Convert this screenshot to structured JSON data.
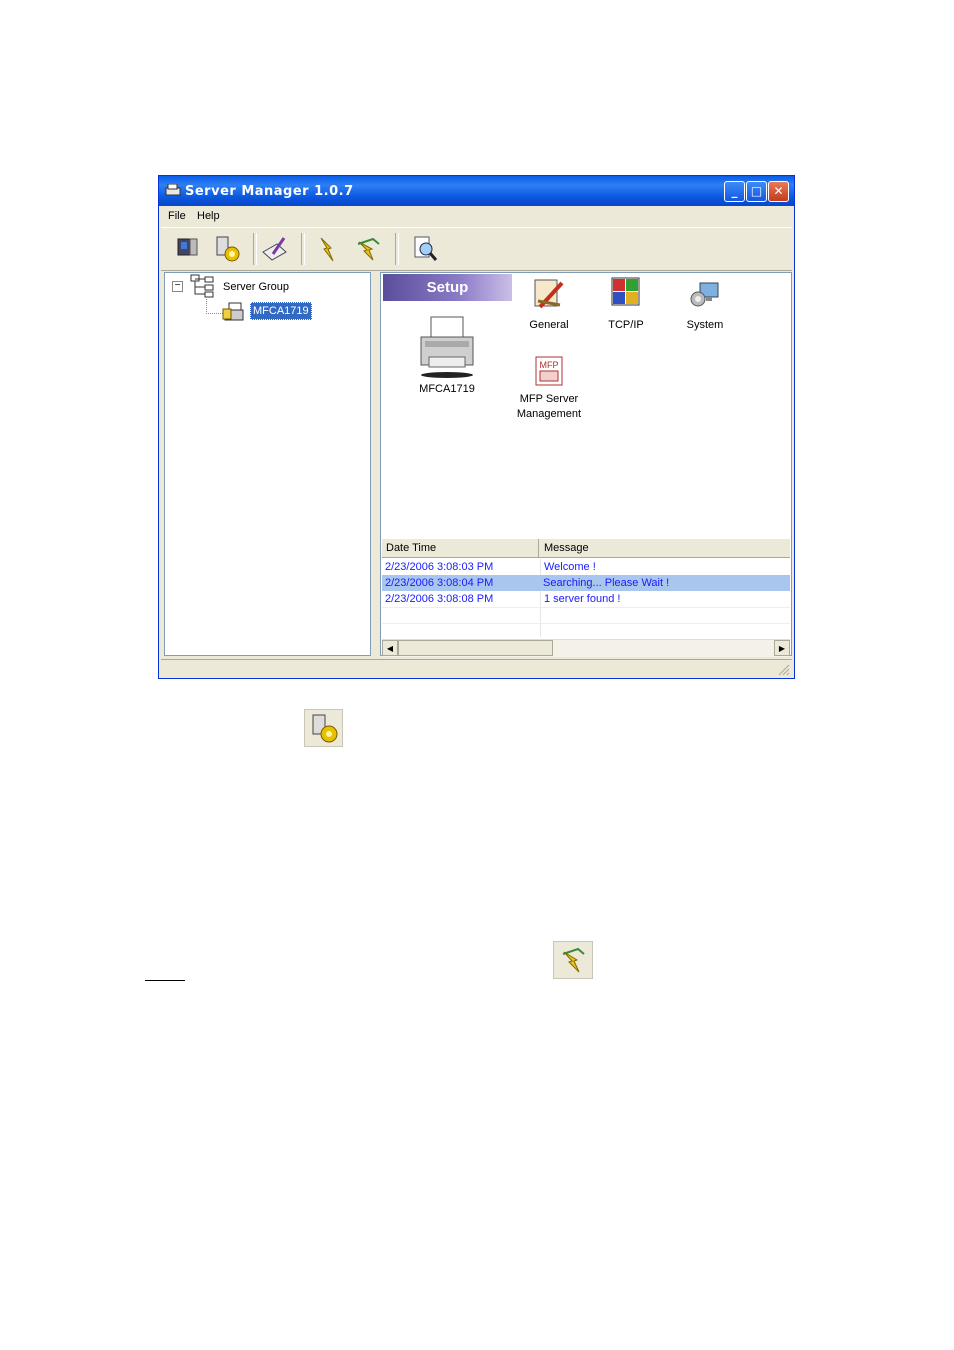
{
  "window": {
    "title": "Server Manager 1.0.7",
    "min_glyph": "_",
    "max_glyph": "□",
    "close_glyph": "✕"
  },
  "menu": {
    "file": "File",
    "help": "Help"
  },
  "toolbar": {
    "buttons": [
      "monitor-icon",
      "server-settings-icon",
      "configure-icon",
      "lightning-icon",
      "disconnect-icon",
      "search-icon"
    ]
  },
  "tree": {
    "root_label": "Server Group",
    "expander": "−",
    "child_label": "MFCA1719"
  },
  "setup": {
    "banner": "Setup",
    "device_label": "MFCA1719",
    "items": {
      "general": "General",
      "tcpip": "TCP/IP",
      "system": "System",
      "mfp_line1": "MFP Server",
      "mfp_line2": "Management",
      "mfp_badge": "MFP"
    }
  },
  "log": {
    "headers": {
      "datetime": "Date Time",
      "message": "Message"
    },
    "rows": [
      {
        "datetime": "2/23/2006 3:08:03 PM",
        "message": "Welcome !"
      },
      {
        "datetime": "2/23/2006 3:08:04 PM",
        "message": "Searching... Please Wait !"
      },
      {
        "datetime": "2/23/2006 3:08:08 PM",
        "message": "1 server found !"
      }
    ]
  },
  "scroll": {
    "left": "◀",
    "right": "▶"
  }
}
